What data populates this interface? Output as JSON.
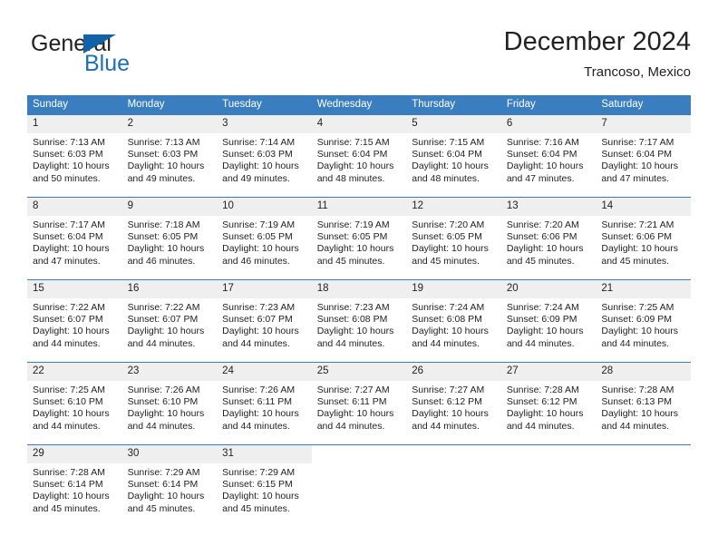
{
  "brand": {
    "name_part1": "General",
    "name_part2": "Blue",
    "logo_icon": "triangle-logo-icon",
    "accent_color": "#1362a8"
  },
  "header": {
    "title": "December 2024",
    "subtitle": "Trancoso, Mexico"
  },
  "calendar": {
    "header_color": "#3a7ebf",
    "daynum_bg": "#efefef",
    "weekdays": [
      "Sunday",
      "Monday",
      "Tuesday",
      "Wednesday",
      "Thursday",
      "Friday",
      "Saturday"
    ],
    "weeks": [
      [
        {
          "day": "1",
          "sunrise": "Sunrise: 7:13 AM",
          "sunset": "Sunset: 6:03 PM",
          "daylight1": "Daylight: 10 hours",
          "daylight2": "and 50 minutes."
        },
        {
          "day": "2",
          "sunrise": "Sunrise: 7:13 AM",
          "sunset": "Sunset: 6:03 PM",
          "daylight1": "Daylight: 10 hours",
          "daylight2": "and 49 minutes."
        },
        {
          "day": "3",
          "sunrise": "Sunrise: 7:14 AM",
          "sunset": "Sunset: 6:03 PM",
          "daylight1": "Daylight: 10 hours",
          "daylight2": "and 49 minutes."
        },
        {
          "day": "4",
          "sunrise": "Sunrise: 7:15 AM",
          "sunset": "Sunset: 6:04 PM",
          "daylight1": "Daylight: 10 hours",
          "daylight2": "and 48 minutes."
        },
        {
          "day": "5",
          "sunrise": "Sunrise: 7:15 AM",
          "sunset": "Sunset: 6:04 PM",
          "daylight1": "Daylight: 10 hours",
          "daylight2": "and 48 minutes."
        },
        {
          "day": "6",
          "sunrise": "Sunrise: 7:16 AM",
          "sunset": "Sunset: 6:04 PM",
          "daylight1": "Daylight: 10 hours",
          "daylight2": "and 47 minutes."
        },
        {
          "day": "7",
          "sunrise": "Sunrise: 7:17 AM",
          "sunset": "Sunset: 6:04 PM",
          "daylight1": "Daylight: 10 hours",
          "daylight2": "and 47 minutes."
        }
      ],
      [
        {
          "day": "8",
          "sunrise": "Sunrise: 7:17 AM",
          "sunset": "Sunset: 6:04 PM",
          "daylight1": "Daylight: 10 hours",
          "daylight2": "and 47 minutes."
        },
        {
          "day": "9",
          "sunrise": "Sunrise: 7:18 AM",
          "sunset": "Sunset: 6:05 PM",
          "daylight1": "Daylight: 10 hours",
          "daylight2": "and 46 minutes."
        },
        {
          "day": "10",
          "sunrise": "Sunrise: 7:19 AM",
          "sunset": "Sunset: 6:05 PM",
          "daylight1": "Daylight: 10 hours",
          "daylight2": "and 46 minutes."
        },
        {
          "day": "11",
          "sunrise": "Sunrise: 7:19 AM",
          "sunset": "Sunset: 6:05 PM",
          "daylight1": "Daylight: 10 hours",
          "daylight2": "and 45 minutes."
        },
        {
          "day": "12",
          "sunrise": "Sunrise: 7:20 AM",
          "sunset": "Sunset: 6:05 PM",
          "daylight1": "Daylight: 10 hours",
          "daylight2": "and 45 minutes."
        },
        {
          "day": "13",
          "sunrise": "Sunrise: 7:20 AM",
          "sunset": "Sunset: 6:06 PM",
          "daylight1": "Daylight: 10 hours",
          "daylight2": "and 45 minutes."
        },
        {
          "day": "14",
          "sunrise": "Sunrise: 7:21 AM",
          "sunset": "Sunset: 6:06 PM",
          "daylight1": "Daylight: 10 hours",
          "daylight2": "and 45 minutes."
        }
      ],
      [
        {
          "day": "15",
          "sunrise": "Sunrise: 7:22 AM",
          "sunset": "Sunset: 6:07 PM",
          "daylight1": "Daylight: 10 hours",
          "daylight2": "and 44 minutes."
        },
        {
          "day": "16",
          "sunrise": "Sunrise: 7:22 AM",
          "sunset": "Sunset: 6:07 PM",
          "daylight1": "Daylight: 10 hours",
          "daylight2": "and 44 minutes."
        },
        {
          "day": "17",
          "sunrise": "Sunrise: 7:23 AM",
          "sunset": "Sunset: 6:07 PM",
          "daylight1": "Daylight: 10 hours",
          "daylight2": "and 44 minutes."
        },
        {
          "day": "18",
          "sunrise": "Sunrise: 7:23 AM",
          "sunset": "Sunset: 6:08 PM",
          "daylight1": "Daylight: 10 hours",
          "daylight2": "and 44 minutes."
        },
        {
          "day": "19",
          "sunrise": "Sunrise: 7:24 AM",
          "sunset": "Sunset: 6:08 PM",
          "daylight1": "Daylight: 10 hours",
          "daylight2": "and 44 minutes."
        },
        {
          "day": "20",
          "sunrise": "Sunrise: 7:24 AM",
          "sunset": "Sunset: 6:09 PM",
          "daylight1": "Daylight: 10 hours",
          "daylight2": "and 44 minutes."
        },
        {
          "day": "21",
          "sunrise": "Sunrise: 7:25 AM",
          "sunset": "Sunset: 6:09 PM",
          "daylight1": "Daylight: 10 hours",
          "daylight2": "and 44 minutes."
        }
      ],
      [
        {
          "day": "22",
          "sunrise": "Sunrise: 7:25 AM",
          "sunset": "Sunset: 6:10 PM",
          "daylight1": "Daylight: 10 hours",
          "daylight2": "and 44 minutes."
        },
        {
          "day": "23",
          "sunrise": "Sunrise: 7:26 AM",
          "sunset": "Sunset: 6:10 PM",
          "daylight1": "Daylight: 10 hours",
          "daylight2": "and 44 minutes."
        },
        {
          "day": "24",
          "sunrise": "Sunrise: 7:26 AM",
          "sunset": "Sunset: 6:11 PM",
          "daylight1": "Daylight: 10 hours",
          "daylight2": "and 44 minutes."
        },
        {
          "day": "25",
          "sunrise": "Sunrise: 7:27 AM",
          "sunset": "Sunset: 6:11 PM",
          "daylight1": "Daylight: 10 hours",
          "daylight2": "and 44 minutes."
        },
        {
          "day": "26",
          "sunrise": "Sunrise: 7:27 AM",
          "sunset": "Sunset: 6:12 PM",
          "daylight1": "Daylight: 10 hours",
          "daylight2": "and 44 minutes."
        },
        {
          "day": "27",
          "sunrise": "Sunrise: 7:28 AM",
          "sunset": "Sunset: 6:12 PM",
          "daylight1": "Daylight: 10 hours",
          "daylight2": "and 44 minutes."
        },
        {
          "day": "28",
          "sunrise": "Sunrise: 7:28 AM",
          "sunset": "Sunset: 6:13 PM",
          "daylight1": "Daylight: 10 hours",
          "daylight2": "and 44 minutes."
        }
      ],
      [
        {
          "day": "29",
          "sunrise": "Sunrise: 7:28 AM",
          "sunset": "Sunset: 6:14 PM",
          "daylight1": "Daylight: 10 hours",
          "daylight2": "and 45 minutes."
        },
        {
          "day": "30",
          "sunrise": "Sunrise: 7:29 AM",
          "sunset": "Sunset: 6:14 PM",
          "daylight1": "Daylight: 10 hours",
          "daylight2": "and 45 minutes."
        },
        {
          "day": "31",
          "sunrise": "Sunrise: 7:29 AM",
          "sunset": "Sunset: 6:15 PM",
          "daylight1": "Daylight: 10 hours",
          "daylight2": "and 45 minutes."
        },
        {
          "day": "",
          "sunrise": "",
          "sunset": "",
          "daylight1": "",
          "daylight2": ""
        },
        {
          "day": "",
          "sunrise": "",
          "sunset": "",
          "daylight1": "",
          "daylight2": ""
        },
        {
          "day": "",
          "sunrise": "",
          "sunset": "",
          "daylight1": "",
          "daylight2": ""
        },
        {
          "day": "",
          "sunrise": "",
          "sunset": "",
          "daylight1": "",
          "daylight2": ""
        }
      ]
    ]
  }
}
